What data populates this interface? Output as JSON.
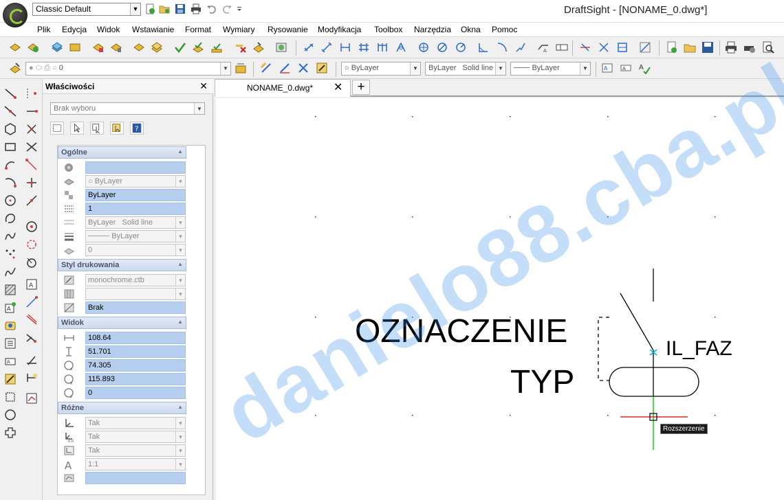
{
  "titlebar": {
    "workspace": "Classic Default",
    "window_title": "DraftSight - [NONAME_0.dwg*]"
  },
  "menu": [
    "Plik",
    "Edycja",
    "Widok",
    "Wstawianie",
    "Format",
    "Wymiary",
    "Rysowanie",
    "Modyfikacja",
    "Toolbox",
    "Narzędzia",
    "Okna",
    "Pomoc"
  ],
  "toolbar2": {
    "layer_value": "0",
    "color_value": "ByLayer",
    "linestyle_value": "ByLayer",
    "linestyle_desc": "Solid line",
    "lineweight_value": "ByLayer"
  },
  "properties": {
    "title": "Właściwości",
    "selection": "Brak wyboru",
    "sections": {
      "general": {
        "title": "Ogólne",
        "color_value": "",
        "layer_value": "ByLayer",
        "linestyle_value": "ByLayer",
        "linescale_value": "1",
        "linestyle_combo": "ByLayer",
        "linestyle_combo_desc": "Solid line",
        "lineweight_value": "ByLayer",
        "transparency_value": "0"
      },
      "print": {
        "title": "Styl drukowania",
        "style_table": "monochrome.ctb",
        "style_value": "",
        "style_name": "Brak"
      },
      "view": {
        "title": "Widok",
        "width": "108.64",
        "height": "51.701",
        "center_x": "74.305",
        "center_y": "115.893",
        "center_z": "0"
      },
      "misc": {
        "title": "Różne",
        "ucs_icon": "Tak",
        "ucs_origin": "Tak",
        "ucs_viewport": "Tak",
        "annotation_scale": "1:1",
        "last_value": ""
      }
    }
  },
  "document": {
    "tab_label": "NONAME_0.dwg*",
    "tab_add": "+"
  },
  "drawing": {
    "text_label1": "OZNACZENIE",
    "text_label2": "TYP",
    "text_label3": "IL_FAZ",
    "tooltip": "Rozszerzenie"
  },
  "watermark": "danielo88.cba.pl",
  "colors": {
    "accent_blue": "#2f8cf0",
    "cursor_green": "#00c000",
    "cursor_red": "#d40000",
    "panel_highlight": "#b6cfee"
  },
  "icons": {
    "close": "close-icon",
    "dropdown": "chevron-down-icon",
    "collapse": "chevron-up-icon"
  }
}
